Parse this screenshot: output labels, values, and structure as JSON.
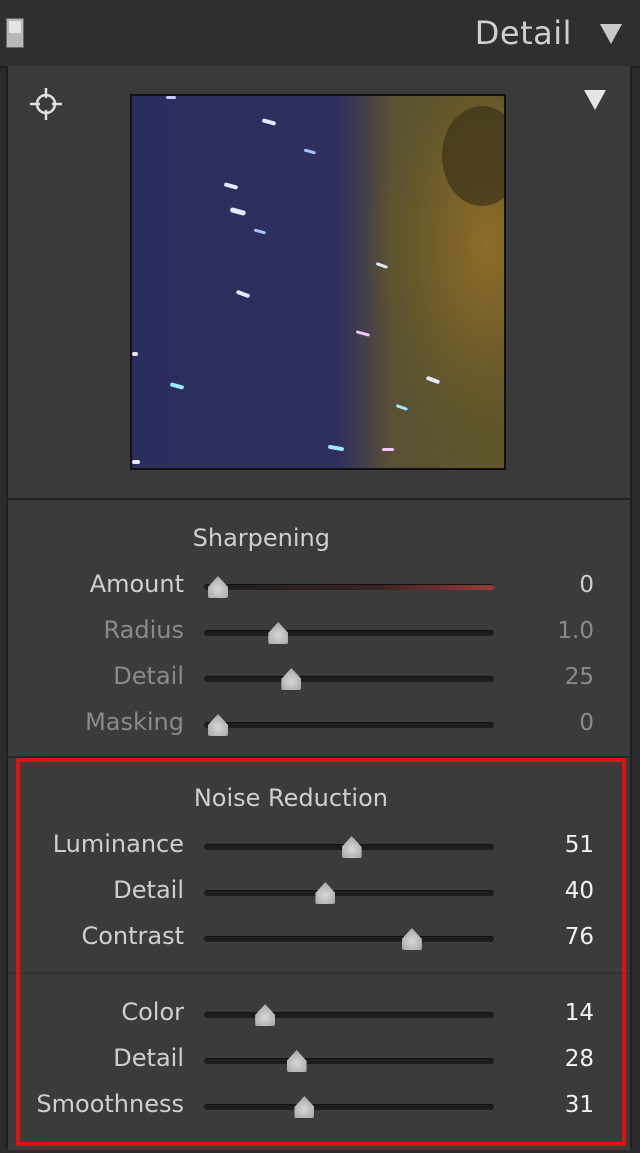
{
  "header": {
    "title": "Detail"
  },
  "sharpening": {
    "title": "Sharpening",
    "rows": [
      {
        "label": "Amount",
        "value": "0",
        "fraction": 0.0
      },
      {
        "label": "Radius",
        "value": "1.0",
        "fraction": 0.23
      },
      {
        "label": "Detail",
        "value": "25",
        "fraction": 0.28
      },
      {
        "label": "Masking",
        "value": "0",
        "fraction": 0.0
      }
    ]
  },
  "noise_reduction": {
    "title": "Noise Reduction",
    "rows": [
      {
        "label": "Luminance",
        "value": "51",
        "fraction": 0.51
      },
      {
        "label": "Detail",
        "value": "40",
        "fraction": 0.41
      },
      {
        "label": "Contrast",
        "value": "76",
        "fraction": 0.74
      },
      {
        "label": "Color",
        "value": "14",
        "fraction": 0.18
      },
      {
        "label": "Detail",
        "value": "28",
        "fraction": 0.3
      },
      {
        "label": "Smoothness",
        "value": "31",
        "fraction": 0.33
      }
    ]
  },
  "colors": {
    "highlight": "#e01010",
    "panel": "#3b3b3b"
  }
}
